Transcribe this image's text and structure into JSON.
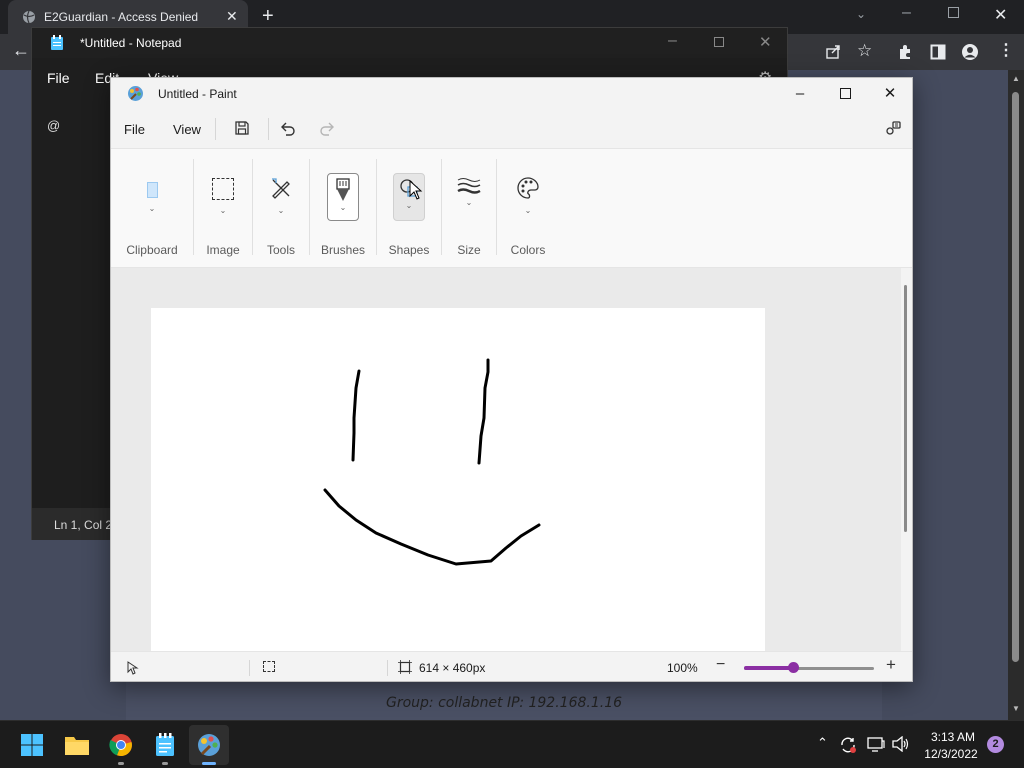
{
  "browser": {
    "tab_title": "E2Guardian - Access Denied",
    "group_text": "Group: collabnet   IP: 192.168.1.16"
  },
  "notepad": {
    "title": "*Untitled - Notepad",
    "menu": [
      "File",
      "Edit",
      "View"
    ],
    "content": "@",
    "status": "Ln 1, Col 2"
  },
  "paint": {
    "title": "Untitled - Paint",
    "menu": {
      "file": "File",
      "view": "View"
    },
    "ribbon": {
      "clipboard": "Clipboard",
      "image": "Image",
      "tools": "Tools",
      "brushes": "Brushes",
      "shapes": "Shapes",
      "size": "Size",
      "colors": "Colors"
    },
    "status": {
      "canvas_size": "614 × 460px",
      "zoom": "100%"
    },
    "zoom_level_fraction": 0.38,
    "accent_color": "#8b2fa3"
  },
  "taskbar": {
    "time": "3:13 AM",
    "date": "12/3/2022",
    "notification_count": "2",
    "apps": [
      "start-icon",
      "file-explorer-icon",
      "chrome-icon",
      "notepad-icon",
      "paint-icon"
    ]
  }
}
